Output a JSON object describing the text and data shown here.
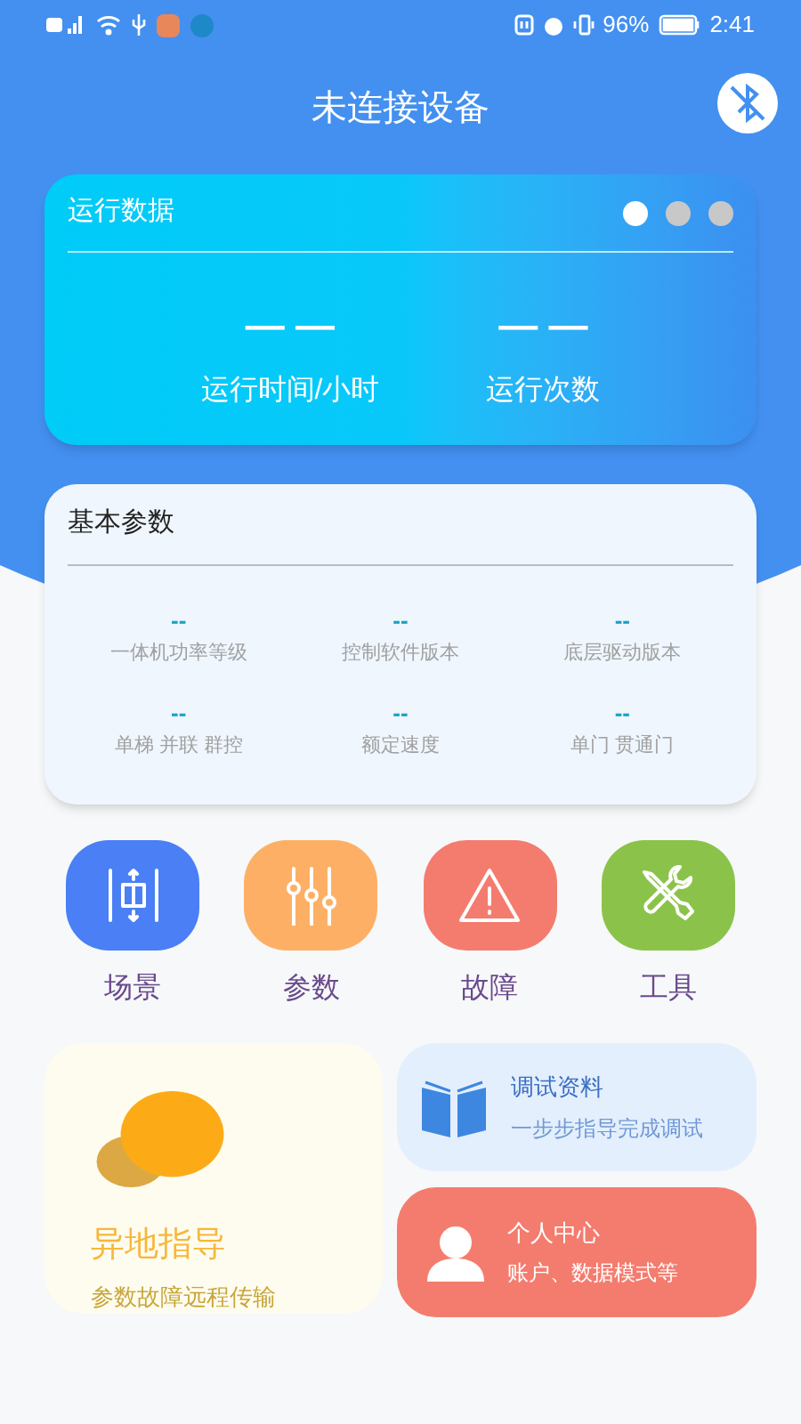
{
  "status_bar": {
    "battery": "96%",
    "time": "2:41"
  },
  "header": {
    "title": "未连接设备"
  },
  "run_data": {
    "title": "运行数据",
    "pager": [
      {
        "selected": true
      },
      {
        "selected": false
      },
      {
        "selected": false
      }
    ],
    "stats": [
      {
        "value": "— —",
        "label": "运行时间/小时"
      },
      {
        "value": "— —",
        "label": "运行次数"
      }
    ]
  },
  "basic_params": {
    "title": "基本参数",
    "items": [
      {
        "value": "--",
        "label": "一体机功率等级"
      },
      {
        "value": "--",
        "label": "控制软件版本"
      },
      {
        "value": "--",
        "label": "底层驱动版本"
      },
      {
        "value": "--",
        "label": "单梯 并联 群控"
      },
      {
        "value": "--",
        "label": "额定速度"
      },
      {
        "value": "--",
        "label": "单门 贯通门"
      }
    ]
  },
  "shortcuts": [
    {
      "kind": "scene",
      "label": "场景",
      "color": "#4a7ff5"
    },
    {
      "kind": "params",
      "label": "参数",
      "color": "#fdb065"
    },
    {
      "kind": "fault",
      "label": "故障",
      "color": "#f47c6e"
    },
    {
      "kind": "tools",
      "label": "工具",
      "color": "#8bc34a"
    }
  ],
  "remote": {
    "title": "异地指导",
    "subtitle": "参数故障远程传输"
  },
  "docs": {
    "title": "调试资料",
    "subtitle": "一步步指导完成调试"
  },
  "profile": {
    "title": "个人中心",
    "subtitle": "账户、数据模式等"
  }
}
